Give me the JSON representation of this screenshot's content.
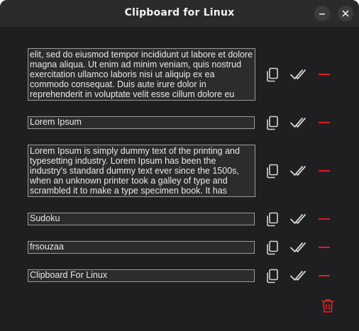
{
  "window": {
    "title": "Clipboard for Linux",
    "minimize_icon": "minimize-icon",
    "close_icon": "close-icon"
  },
  "colors": {
    "background": "#1f1f21",
    "titlebar": "#2b2b2d",
    "field_bg": "#2c2c2e",
    "field_border": "#9a9a9a",
    "text": "#e9e9e9",
    "delete_red": "#e01b24"
  },
  "entries": [
    {
      "text": "elit, sed do eiusmod tempor incididunt ut labore et dolore magna aliqua. Ut enim ad minim veniam, quis nostrud exercitation ullamco laboris nisi ut aliquip ex ea commodo consequat. Duis aute irure dolor in reprehenderit in voluptate velit esse cillum dolore eu fugiat nulla pariatur."
    },
    {
      "text": "Lorem Ipsum"
    },
    {
      "text": "Lorem Ipsum is simply dummy text of the printing and typesetting industry. Lorem Ipsum has been the industry's standard dummy text ever since the 1500s, when an unknown printer took a galley of type and scrambled it to make a type specimen book. It has"
    },
    {
      "text": " Sudoku"
    },
    {
      "text": "frsouzaa"
    },
    {
      "text": "Clipboard For Linux"
    }
  ],
  "actions": {
    "copy_icon": "copy-icon",
    "confirm_icon": "check-icon",
    "remove_icon": "minus-icon",
    "clear_all_icon": "trash-icon"
  }
}
